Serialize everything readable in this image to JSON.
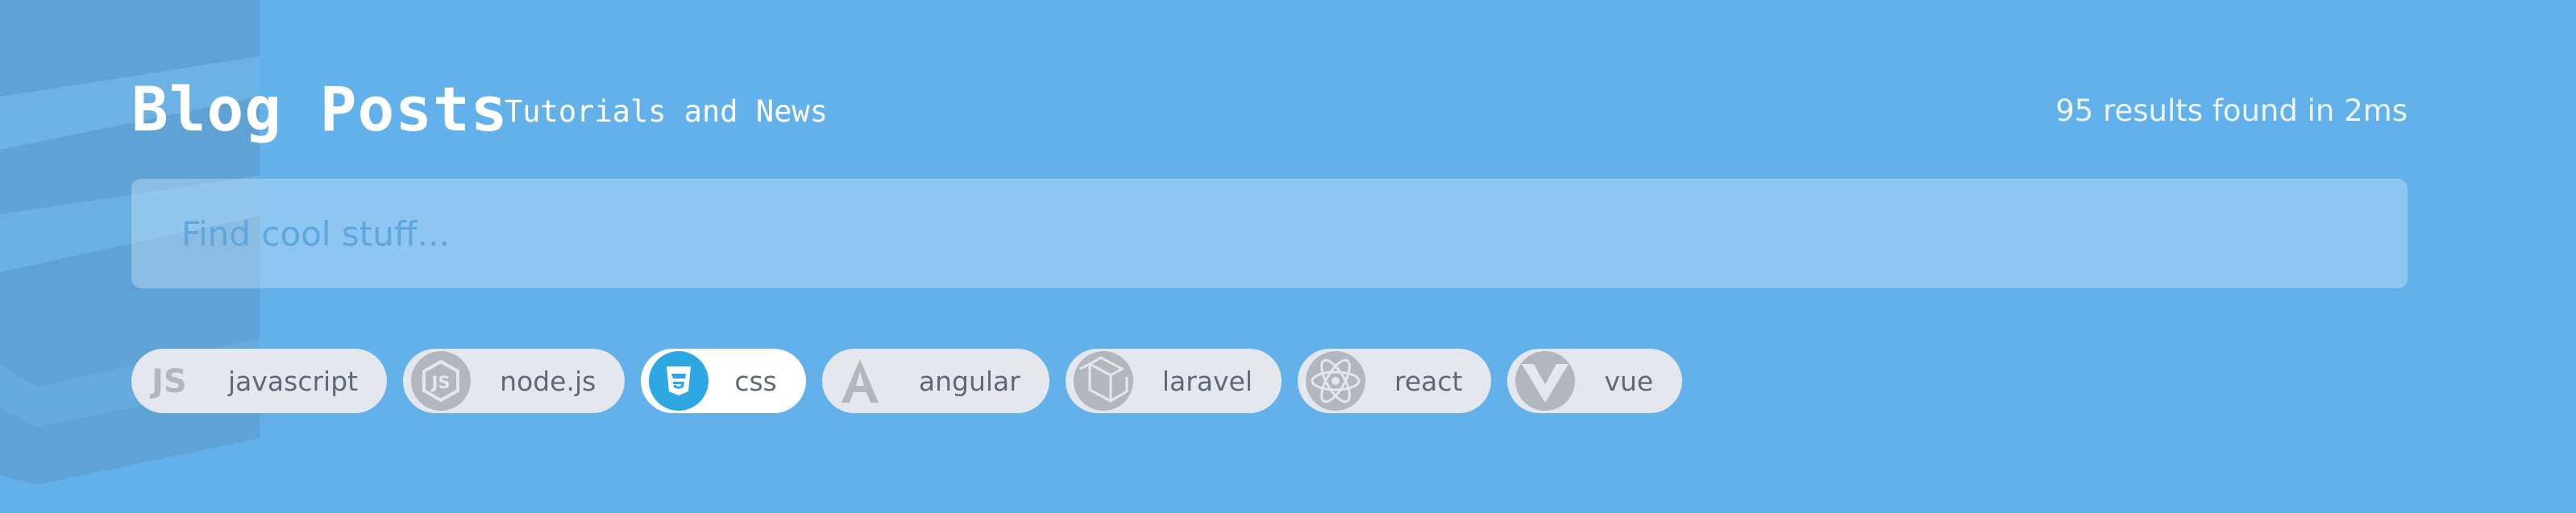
{
  "header": {
    "title": "Blog Posts",
    "subtitle": "Tutorials and News",
    "results": "95 results found in 2ms"
  },
  "search": {
    "value": "",
    "placeholder": "Find cool stuff..."
  },
  "tags": [
    {
      "label": "javascript",
      "icon": "javascript-icon",
      "active": false
    },
    {
      "label": "node.js",
      "icon": "nodejs-icon",
      "active": false
    },
    {
      "label": "css",
      "icon": "css-icon",
      "active": true
    },
    {
      "label": "angular",
      "icon": "angular-icon",
      "active": false
    },
    {
      "label": "laravel",
      "icon": "laravel-icon",
      "active": false
    },
    {
      "label": "react",
      "icon": "react-icon",
      "active": false
    },
    {
      "label": "vue",
      "icon": "vue-icon",
      "active": false
    }
  ],
  "colors": {
    "background": "#62b1ea",
    "tag_background": "#e4e8ee",
    "tag_active_background": "#ffffff",
    "tag_text": "#5d6978",
    "icon_gray": "#b2b7bf",
    "css_blue": "#2ea8e2"
  }
}
